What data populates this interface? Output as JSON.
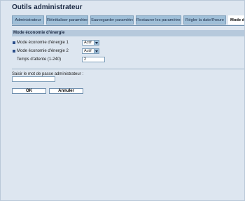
{
  "app": {
    "title": "Outils administrateur"
  },
  "tabs": [
    {
      "label": "Administrateur",
      "active": false
    },
    {
      "label": "Réinitialiser paramètres",
      "active": false
    },
    {
      "label": "Sauvegarder paramètres",
      "active": false
    },
    {
      "label": "Restaurer les paramètres",
      "active": false
    },
    {
      "label": "Régler la date/l'heure",
      "active": false
    },
    {
      "label": "Mode éco",
      "active": true
    }
  ],
  "section": {
    "title": "Mode économie d'énergie",
    "rows": [
      {
        "label": "Mode économie d'énergie 1",
        "value": "Actif"
      },
      {
        "label": "Mode économie d'énergie 2",
        "value": "Actif"
      }
    ],
    "timeout": {
      "label": "Temps d'attente (1-240)",
      "value": "2"
    }
  },
  "password": {
    "label": "Saisir le mot de passe administrateur :",
    "value": ""
  },
  "buttons": {
    "ok": "OK",
    "cancel": "Annuler"
  },
  "colors": {
    "background": "#dde6f0",
    "tab": "#9fbfd8",
    "section": "#b6c9dc",
    "bullet": "#2c4f8a"
  }
}
